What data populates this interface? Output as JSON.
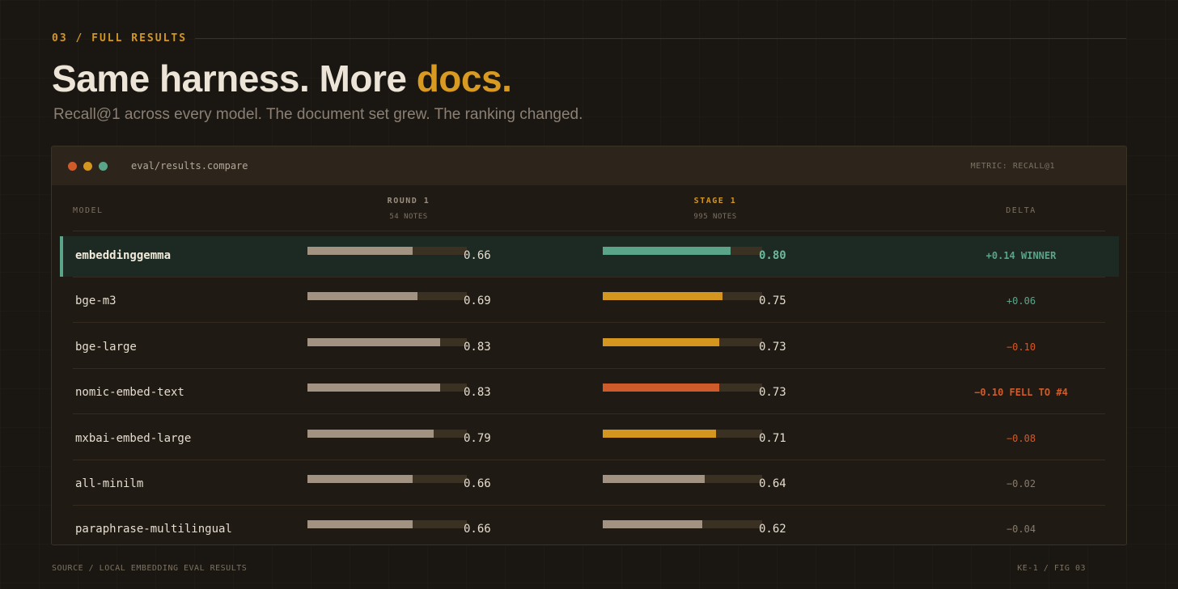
{
  "section": {
    "eyebrow": "03 / FULL RESULTS"
  },
  "headline": {
    "lead": "Same harness. More ",
    "accent": "docs."
  },
  "subtitle": "Recall@1 across every model. The document set grew. The ranking changed.",
  "window": {
    "path": "eval/results.compare",
    "metric": "METRIC: RECALL@1"
  },
  "columns": {
    "model": "MODEL",
    "round": {
      "label": "ROUND 1",
      "sub": "54 NOTES"
    },
    "stage": {
      "label": "STAGE 1",
      "sub": "995 NOTES"
    },
    "delta": "DELTA"
  },
  "colors": {
    "accent": "#d99a22",
    "green": "#5aa58a",
    "orange": "#cf5b2b",
    "neutral": "#a19282"
  },
  "rows": [
    {
      "model": "embeddinggemma",
      "round": 0.66,
      "round_label": "0.66",
      "stage": 0.8,
      "stage_label": "0.80",
      "stage_color": "green",
      "delta": "+0.14 WINNER",
      "delta_tone": "pos",
      "winner": true
    },
    {
      "model": "bge-m3",
      "round": 0.69,
      "round_label": "0.69",
      "stage": 0.75,
      "stage_label": "0.75",
      "stage_color": "amber",
      "delta": "+0.06",
      "delta_tone": "pos"
    },
    {
      "model": "bge-large",
      "round": 0.83,
      "round_label": "0.83",
      "stage": 0.73,
      "stage_label": "0.73",
      "stage_color": "amber",
      "delta": "−0.10",
      "delta_tone": "neg"
    },
    {
      "model": "nomic-embed-text",
      "round": 0.83,
      "round_label": "0.83",
      "stage": 0.73,
      "stage_label": "0.73",
      "stage_color": "orange",
      "delta": "−0.10 FELL TO #4",
      "delta_tone": "neg",
      "delta_bold": true
    },
    {
      "model": "mxbai-embed-large",
      "round": 0.79,
      "round_label": "0.79",
      "stage": 0.71,
      "stage_label": "0.71",
      "stage_color": "amber",
      "delta": "−0.08",
      "delta_tone": "neg"
    },
    {
      "model": "all-minilm",
      "round": 0.66,
      "round_label": "0.66",
      "stage": 0.64,
      "stage_label": "0.64",
      "stage_color": "gray",
      "delta": "−0.02",
      "delta_tone": "neutral"
    },
    {
      "model": "paraphrase-multilingual",
      "round": 0.66,
      "round_label": "0.66",
      "stage": 0.62,
      "stage_label": "0.62",
      "stage_color": "gray",
      "delta": "−0.04",
      "delta_tone": "neutral"
    }
  ],
  "footer": {
    "source": "SOURCE / LOCAL EMBEDDING EVAL RESULTS",
    "figure": "KE-1 / FIG 03"
  }
}
